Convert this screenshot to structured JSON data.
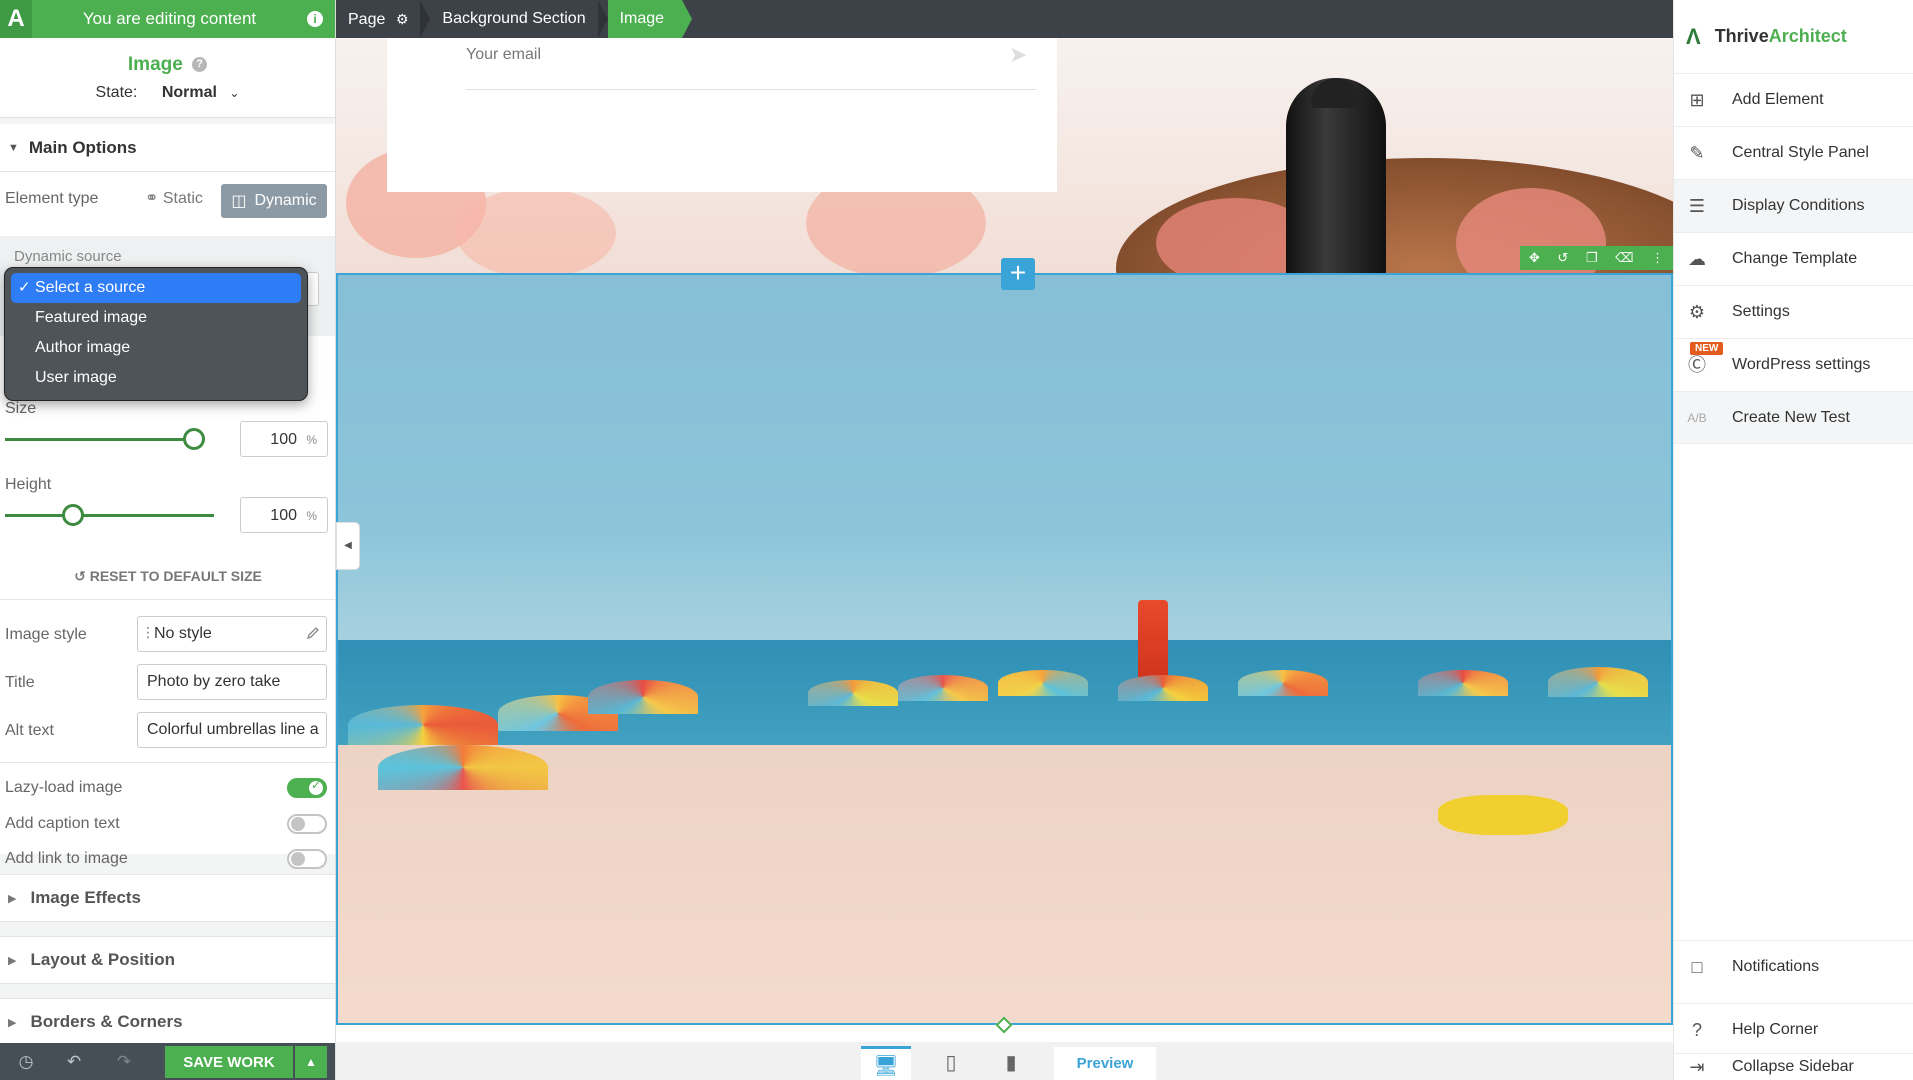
{
  "editor": {
    "editing_banner": "You are editing content",
    "element_name": "Image",
    "state_label": "State:",
    "state_value": "Normal"
  },
  "breadcrumbs": [
    {
      "label": "Page"
    },
    {
      "label": "Background Section"
    },
    {
      "label": "Image"
    }
  ],
  "main_options": {
    "title": "Main Options",
    "element_type_label": "Element type",
    "static_label": "Static",
    "dynamic_label": "Dynamic",
    "dynamic_source_label": "Dynamic source",
    "dropdown_options": [
      "Select a source",
      "Featured image",
      "Author image",
      "User image"
    ],
    "dropdown_selected": "Select a source",
    "size_label": "Size",
    "size_value": "100",
    "size_unit": "%",
    "height_label": "Height",
    "height_value": "100",
    "height_unit": "%",
    "size_slider_fraction": 0.92,
    "height_slider_fraction": 0.33,
    "reset_label": "RESET TO DEFAULT SIZE",
    "image_style_label": "Image style",
    "image_style_value": "No style",
    "title_label": "Title",
    "title_value": "Photo by zero take",
    "alt_label": "Alt text",
    "alt_value": "Colorful umbrellas line a",
    "lazy_label": "Lazy-load image",
    "lazy_on": true,
    "caption_label": "Add caption text",
    "caption_on": false,
    "link_label": "Add link to image",
    "link_on": false
  },
  "collapsed_sections": [
    "Image Effects",
    "Layout & Position",
    "Borders & Corners"
  ],
  "bottom_bar": {
    "save_label": "SAVE WORK"
  },
  "canvas": {
    "email_placeholder": "Your email"
  },
  "device_bar": {
    "preview_label": "Preview"
  },
  "sidebar": {
    "brand_part1": "Thrive",
    "brand_part2": "Architect",
    "items": [
      {
        "label": "Add Element",
        "icon": "plus-square-icon"
      },
      {
        "label": "Central Style Panel",
        "icon": "brush-icon"
      },
      {
        "label": "Display Conditions",
        "icon": "sliders-icon"
      },
      {
        "label": "Change Template",
        "icon": "cloud-download-icon"
      },
      {
        "label": "Settings",
        "icon": "gear-icon"
      },
      {
        "label": "WordPress settings",
        "icon": "wordpress-icon",
        "badge": "NEW"
      },
      {
        "label": "Create New Test",
        "icon": "ab-test-icon"
      }
    ],
    "bottom_items": [
      {
        "label": "Notifications",
        "icon": "notification-icon"
      },
      {
        "label": "Help Corner",
        "icon": "help-icon"
      },
      {
        "label": "Collapse Sidebar",
        "icon": "collapse-icon"
      }
    ]
  },
  "colors": {
    "brand_green": "#4caf50",
    "selection_blue": "#3aa4d8",
    "dropdown_highlight": "#2e7cf6"
  }
}
